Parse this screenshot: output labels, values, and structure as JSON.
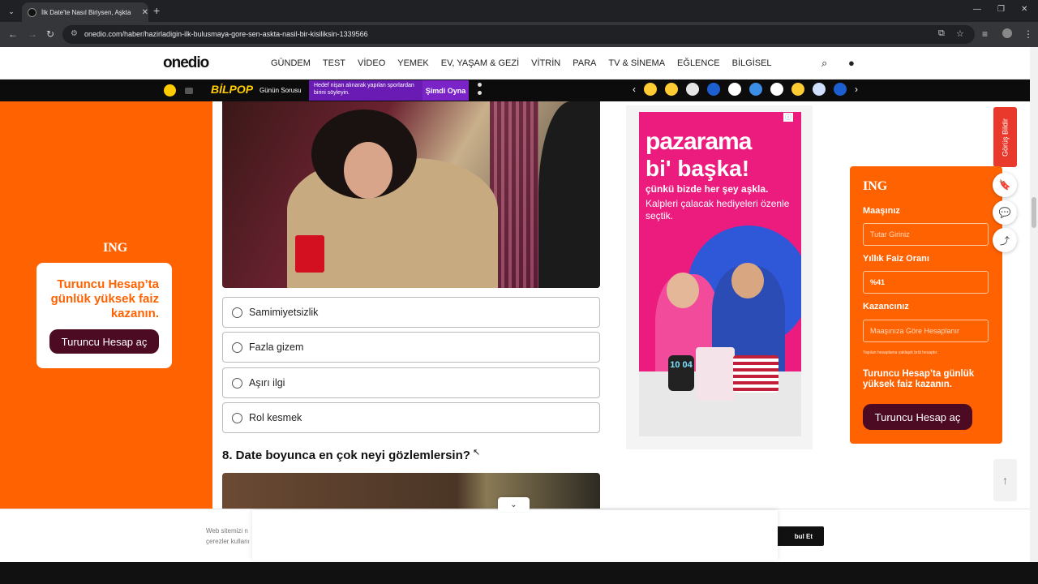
{
  "browser": {
    "tab_title": "İlk Date'te Nasıl Biriysen, Aşkta",
    "url": "onedio.com/haber/hazirladigin-ilk-bulusmaya-gore-sen-askta-nasil-bir-kisiliksin-1339566",
    "new_tab_symbol": "+"
  },
  "site": {
    "logo": "onedio",
    "menu": [
      "GÜNDEM",
      "TEST",
      "VİDEO",
      "YEMEK",
      "EV, YAŞAM & GEZİ",
      "VİTRİN",
      "PARA",
      "TV & SİNEMA",
      "EĞLENCE",
      "BİLGİSEL"
    ]
  },
  "strip": {
    "bilpop": "BİLPOP",
    "gunun_sorusu": "Günün Sorusu",
    "quiz_text": "Hedef nişan alınarak yapılan sporlardan birini söyleyin.",
    "play_label": "Şimdi Oyna"
  },
  "left_ad": {
    "logo": "ING",
    "message": "Turuncu Hesap’ta günlük yüksek faiz kazanın.",
    "button": "Turuncu Hesap aç"
  },
  "quiz": {
    "options": [
      "Samimiyetsizlik",
      "Fazla gizem",
      "Aşırı ilgi",
      "Rol kesmek"
    ],
    "next_question": "8. Date boyunca en çok neyi gözlemlersin?"
  },
  "right_ad": {
    "brand": "pazarama",
    "headline": "bi' başka!",
    "sub1": "çünkü bizde her şey aşkla.",
    "sub2": "Kalpleri çalacak hediyeleri özenle seçtik.",
    "watch": "10 04"
  },
  "ing_widget": {
    "feedback": "Görüş Bildir",
    "logo": "ING",
    "label_salary": "Maaşınız",
    "placeholder_salary": "Tutar Giriniz",
    "label_rate": "Yıllık Faiz Oranı",
    "rate_value": "%41",
    "label_earn": "Kazancınız",
    "placeholder_earn": "Maaşınıza Göre Hesaplanır",
    "note": "Yapılan hesaplama yaklaşık brüt hesaptır.",
    "cta": "Turuncu Hesap’ta günlük yüksek faiz kazanın.",
    "button": "Turuncu Hesap aç"
  },
  "cookie": {
    "text_line1": "Web sitemizi n",
    "text_line2": "çerezler kullanı",
    "accept": "bul Et"
  },
  "colors": {
    "ing_orange": "#ff6200",
    "ing_button": "#4c0a23",
    "ad_pink": "#ec1b7e",
    "bilpop_purple": "#6a1bb4"
  }
}
